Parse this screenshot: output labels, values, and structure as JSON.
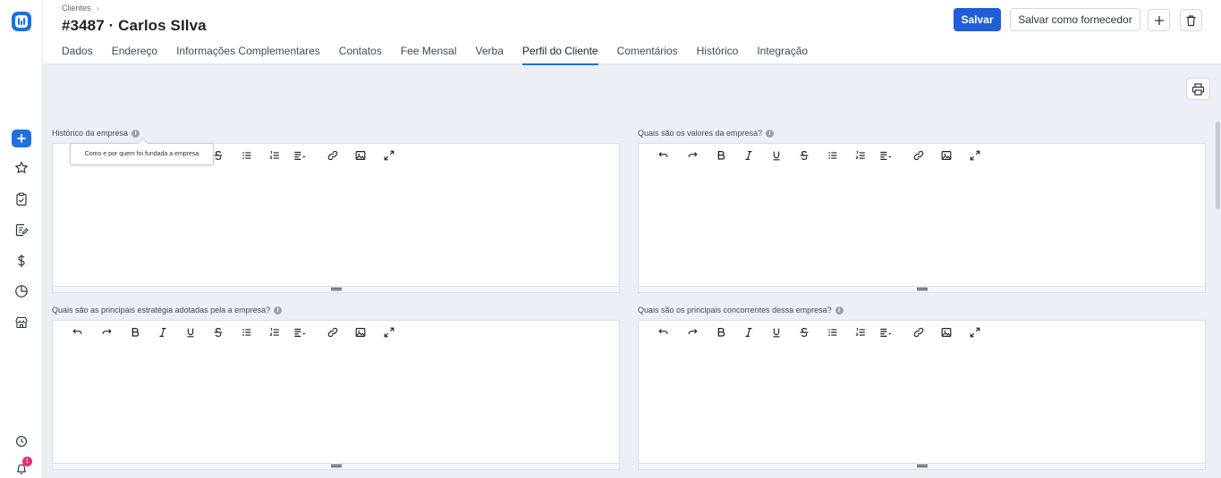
{
  "app": {
    "breadcrumb": "Clientes",
    "title": "#3487 · Carlos SIlva"
  },
  "tabs": [
    {
      "label": "Dados"
    },
    {
      "label": "Endereço"
    },
    {
      "label": "Informações Complementares"
    },
    {
      "label": "Contatos"
    },
    {
      "label": "Fee Mensal"
    },
    {
      "label": "Verba"
    },
    {
      "label": "Perfil do Cliente",
      "active": true
    },
    {
      "label": "Comentários"
    },
    {
      "label": "Histórico"
    },
    {
      "label": "Integração"
    }
  ],
  "actions": {
    "save_label": "Salvar",
    "save_supplier_label": "Salvar como fornecedor",
    "add_icon": "plus-icon",
    "delete_icon": "trash-icon",
    "print_icon": "printer-icon"
  },
  "fields": [
    {
      "label": "Histórico da empresa"
    },
    {
      "label": "Quais são os valores da empresa?"
    },
    {
      "label": "Quais são as principais estratégia adotadas pela a empresa?"
    },
    {
      "label": "Quais são os principais concorrentes dessa empresa?"
    }
  ],
  "tooltip": {
    "text": "Como e por quem foi fundada a empresa"
  },
  "sidebar": {
    "notification_count": "1",
    "icons": [
      "logo-icon",
      "plus-icon",
      "star-icon",
      "clipboard-check-icon",
      "notes-edit-icon",
      "dollar-icon",
      "pie-chart-icon",
      "store-icon",
      "clock-icon",
      "bell-icon"
    ]
  },
  "colors": {
    "primary": "#1f5ed8",
    "accent": "#1f6fe0",
    "badge": "#e0307a",
    "background": "#eceff6"
  }
}
